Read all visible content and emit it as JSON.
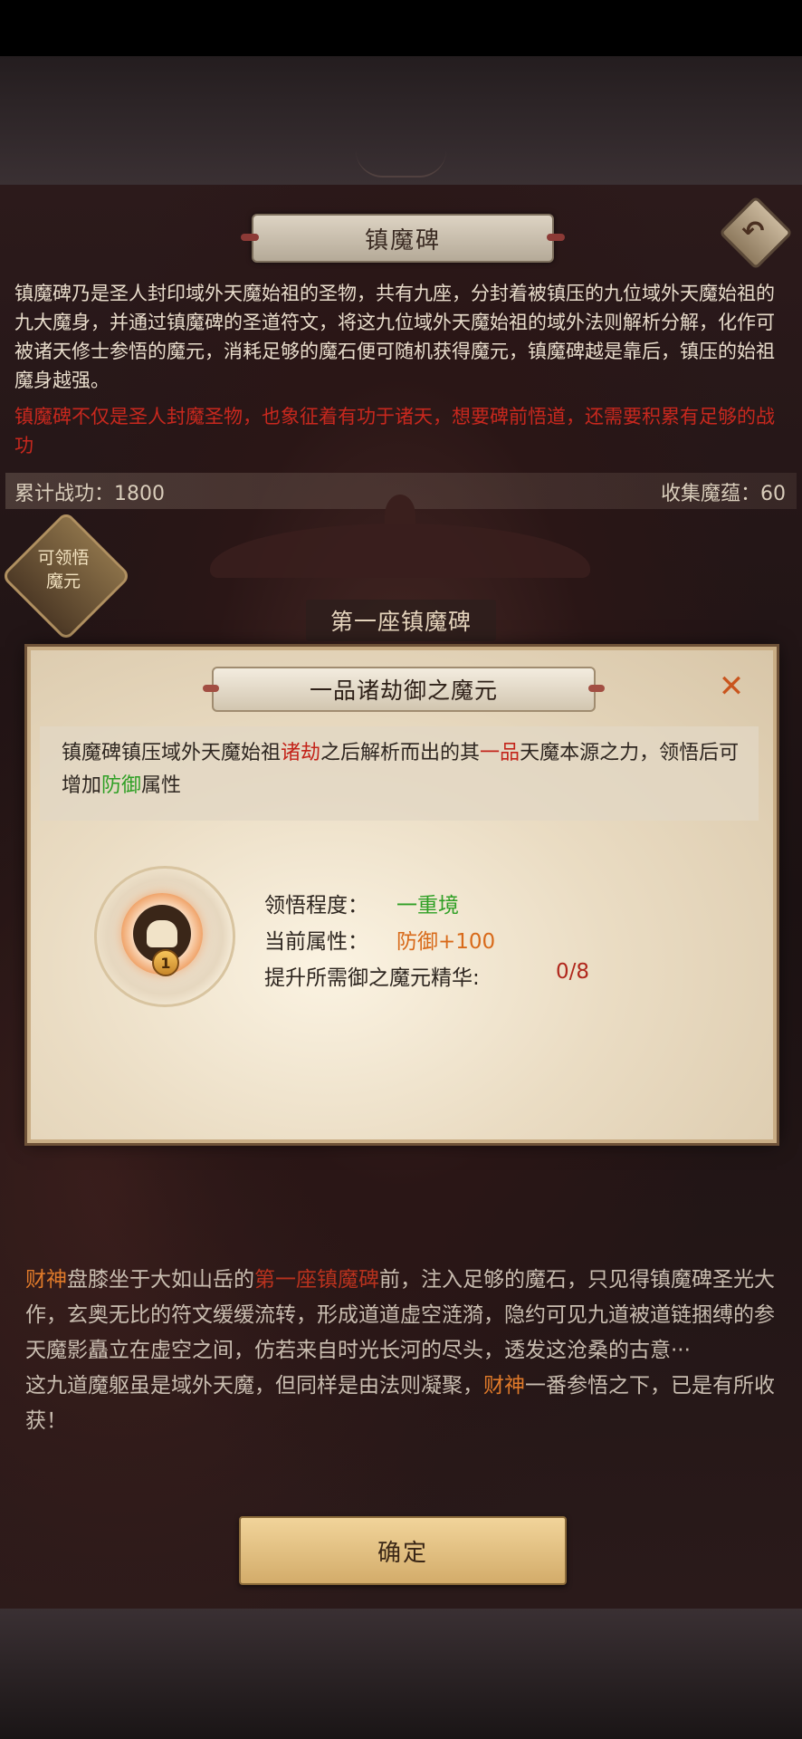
{
  "header": {
    "title": "镇魔碑",
    "back_icon": "back-arrow-icon"
  },
  "intro": {
    "text": "镇魔碑乃是圣人封印域外天魔始祖的圣物，共有九座，分封着被镇压的九位域外天魔始祖的九大魔身，并通过镇魔碑的圣道符文，将这九位域外天魔始祖的域外法则解析分解，化作可被诸天修士参悟的魔元，消耗足够的魔石便可随机获得魔元，镇魔碑越是靠后，镇压的始祖魔身越强。",
    "warning": "镇魔碑不仅是圣人封魔圣物，也象征着有功于诸天，想要碑前悟道，还需要积累有足够的战功"
  },
  "stats": {
    "merit_label": "累计战功：",
    "merit_value": "1800",
    "collected_label": "收集魔蕴：",
    "collected_value": "60"
  },
  "comprehend_badge": {
    "line1": "可领悟",
    "line2": "魔元"
  },
  "stele": {
    "name": "第一座镇魔碑"
  },
  "modal": {
    "title": "一品诸劫御之魔元",
    "close_icon": "close-x-icon",
    "description": {
      "p1": "镇魔碑镇压域外天魔始祖",
      "h1": "诸劫",
      "p2": "之后解析而出的其",
      "h2": "一品",
      "p3": "天魔本源之力，领悟后可增加",
      "h3": "防御",
      "p4": "属性"
    },
    "medallion": {
      "icon": "helmet-icon",
      "level": "1"
    },
    "attributes": {
      "comprehension_label": "领悟程度：",
      "comprehension_value": "一重境",
      "current_label": "当前属性：",
      "current_value": "防御+100",
      "required_label": "提升所需御之魔元精华:",
      "required_value": "0/8"
    }
  },
  "story": {
    "s1": "财神",
    "s2": "盘膝坐于大如山岳的",
    "s3": "第一座镇魔碑",
    "s4": "前，注入足够的魔石，只见得镇魔碑圣光大作，玄奥无比的符文缓缓流转，形成道道虚空涟漪，隐约可见九道被道链捆缚的参天魔影矗立在虚空之间，仿若来自时光长河的尽头，透发这沧桑的古意···",
    "s5": "这九道魔躯虽是域外天魔，但同样是由法则凝聚，",
    "s6": "财神",
    "s7": "一番参悟之下，已是有所收获！"
  },
  "confirm": {
    "label": "确定"
  },
  "colors": {
    "accent_red": "#c3241a",
    "accent_green": "#2e9f24",
    "accent_orange": "#d86a1a",
    "parchment": "#eadcc3"
  }
}
